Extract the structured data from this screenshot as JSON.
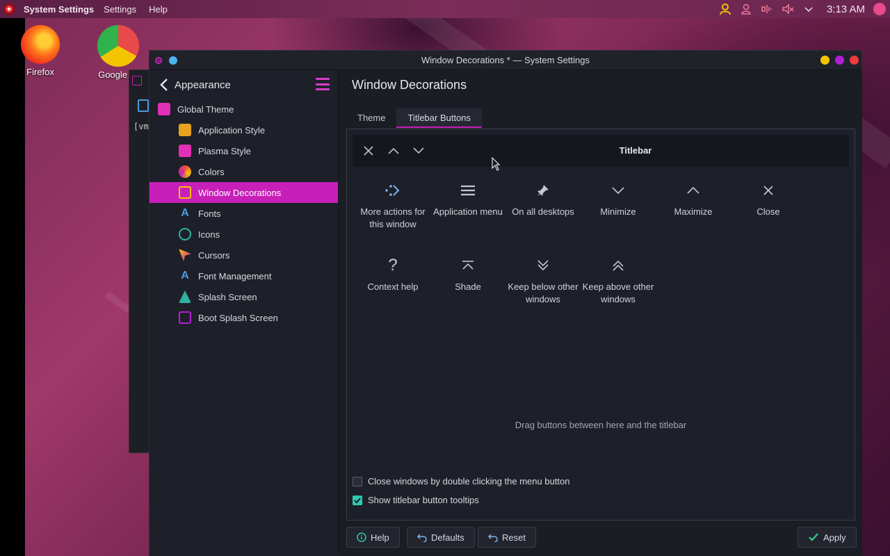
{
  "top_panel": {
    "app_name": "System Settings",
    "menus": [
      "Settings",
      "Help"
    ],
    "clock": "3:13 AM",
    "tray_icons": [
      "user-icon",
      "person-icon",
      "audio-input-icon",
      "volume-muted-icon",
      "chevron-down-icon"
    ]
  },
  "desktop": {
    "icons": [
      {
        "label": "Firefox",
        "icon": "firefox-icon"
      },
      {
        "label": "Google Cl",
        "icon": "chrome-icon"
      }
    ],
    "terminal_text": "[vm"
  },
  "window": {
    "title": "Window Decorations * — System Settings",
    "controls": {
      "minimize_color": "#f5c400",
      "maximize_color": "#b31fd8",
      "close_color": "#ef3b3b"
    }
  },
  "sidebar": {
    "header": "Appearance",
    "items": [
      {
        "label": "Global Theme",
        "level": "root",
        "icon": "global-theme-icon"
      },
      {
        "label": "Application Style",
        "level": "child",
        "icon": "application-style-icon"
      },
      {
        "label": "Plasma Style",
        "level": "child",
        "icon": "plasma-style-icon"
      },
      {
        "label": "Colors",
        "level": "child",
        "icon": "colors-icon"
      },
      {
        "label": "Window Decorations",
        "level": "child",
        "icon": "window-decorations-icon",
        "active": true
      },
      {
        "label": "Fonts",
        "level": "child",
        "icon": "fonts-icon"
      },
      {
        "label": "Icons",
        "level": "child",
        "icon": "icons-icon"
      },
      {
        "label": "Cursors",
        "level": "child",
        "icon": "cursors-icon"
      },
      {
        "label": "Font Management",
        "level": "child",
        "icon": "font-management-icon"
      },
      {
        "label": "Splash Screen",
        "level": "child",
        "icon": "splash-screen-icon"
      },
      {
        "label": "Boot Splash Screen",
        "level": "child",
        "icon": "boot-splash-screen-icon"
      }
    ]
  },
  "main": {
    "title": "Window Decorations",
    "tabs": [
      {
        "label": "Theme",
        "active": false
      },
      {
        "label": "Titlebar Buttons",
        "active": true
      }
    ],
    "titlebar_preview": {
      "title": "Titlebar",
      "buttons": [
        "close-icon",
        "maximize-icon",
        "minimize-icon"
      ]
    },
    "available_buttons": [
      {
        "label": "More actions for this window",
        "icon": "more-actions-icon"
      },
      {
        "label": "Application menu",
        "icon": "application-menu-icon"
      },
      {
        "label": "On all desktops",
        "icon": "pin-icon"
      },
      {
        "label": "Minimize",
        "icon": "minimize-icon"
      },
      {
        "label": "Maximize",
        "icon": "maximize-icon"
      },
      {
        "label": "Close",
        "icon": "close-icon"
      },
      {
        "label": "Context help",
        "icon": "help-icon"
      },
      {
        "label": "Shade",
        "icon": "shade-icon"
      },
      {
        "label": "Keep below other windows",
        "icon": "keep-below-icon"
      },
      {
        "label": "Keep above other windows",
        "icon": "keep-above-icon"
      }
    ],
    "hint": "Drag buttons between here and the titlebar",
    "options": [
      {
        "label": "Close windows by double clicking the menu button",
        "checked": false
      },
      {
        "label": "Show titlebar button tooltips",
        "checked": true
      }
    ]
  },
  "footer": {
    "help": "Help",
    "defaults": "Defaults",
    "reset": "Reset",
    "apply": "Apply"
  },
  "colors": {
    "accent": "#c81fb8",
    "check": "#2cc9b0"
  }
}
